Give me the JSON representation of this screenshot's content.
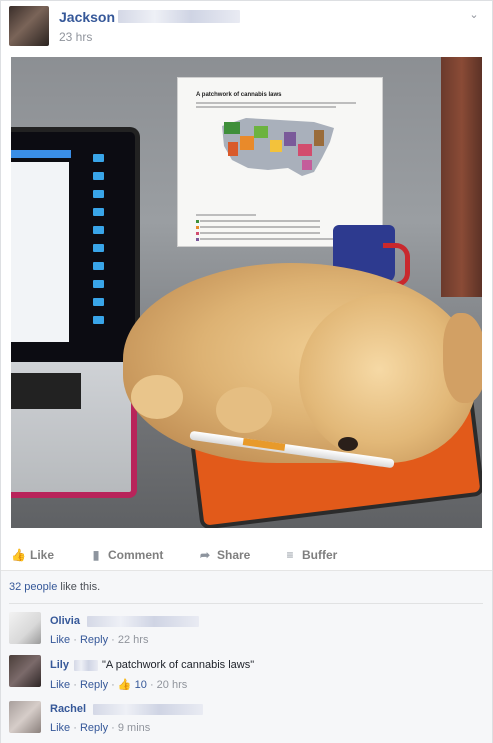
{
  "post": {
    "author": "Jackson",
    "timestamp": "23 hrs",
    "poster_title": "A patchwork of cannabis laws",
    "actions": [
      "Like",
      "Comment",
      "Share",
      "Buffer"
    ]
  },
  "likes": {
    "count_text": "32 people",
    "suffix": " like this."
  },
  "comments": [
    {
      "name": "Olivia",
      "text": "",
      "like": "Like",
      "reply": "Reply",
      "time": "22 hrs",
      "likes_count": ""
    },
    {
      "name": "Lily",
      "text": "\"A patchwork of cannabis laws\"",
      "like": "Like",
      "reply": "Reply",
      "time": "20 hrs",
      "likes_count": "10"
    },
    {
      "name": "Rachel",
      "text": "",
      "like": "Like",
      "reply": "Reply",
      "time": "9 mins",
      "likes_count": ""
    }
  ],
  "icons": {
    "chevron": "chevron-down-icon",
    "like": "thumbs-up-icon",
    "comment": "speech-bubble-icon",
    "share": "share-arrow-icon",
    "buffer": "layers-icon"
  },
  "colors": {
    "link": "#365899",
    "meta": "#90949c",
    "footer_bg": "#f6f7f9"
  }
}
